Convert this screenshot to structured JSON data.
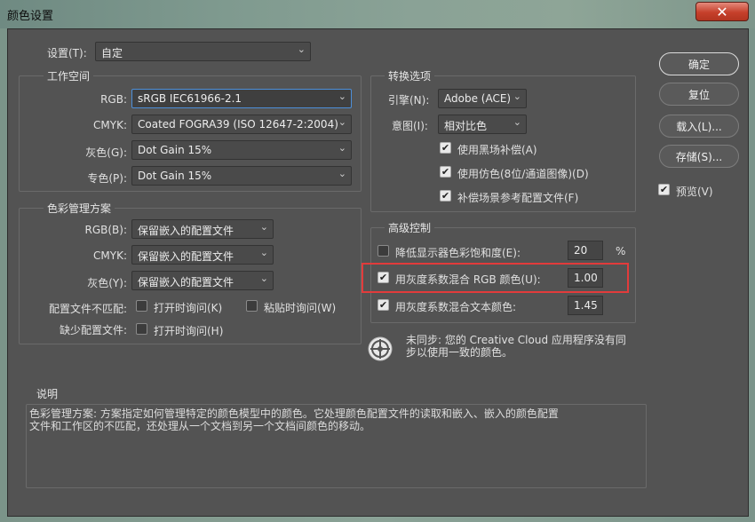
{
  "window": {
    "title": "颜色设置",
    "close_glyph": "✕"
  },
  "settings": {
    "label": "设置(T):",
    "value": "自定"
  },
  "workspace": {
    "title": "工作空间",
    "rgb": {
      "label": "RGB:",
      "value": "sRGB IEC61966-2.1"
    },
    "cmyk": {
      "label": "CMYK:",
      "value": "Coated FOGRA39 (ISO 12647-2:2004)"
    },
    "gray": {
      "label": "灰色(G):",
      "value": "Dot Gain 15%"
    },
    "spot": {
      "label": "专色(P):",
      "value": "Dot Gain 15%"
    }
  },
  "policies": {
    "title": "色彩管理方案",
    "rgb": {
      "label": "RGB(B):",
      "value": "保留嵌入的配置文件"
    },
    "cmyk": {
      "label": "CMYK:",
      "value": "保留嵌入的配置文件"
    },
    "gray": {
      "label": "灰色(Y):",
      "value": "保留嵌入的配置文件"
    },
    "mismatch_label": "配置文件不匹配:",
    "ask_open": "打开时询问(K)",
    "ask_paste": "粘贴时询问(W)",
    "missing_label": "缺少配置文件:",
    "ask_open_missing": "打开时询问(H)"
  },
  "conversion": {
    "title": "转换选项",
    "engine": {
      "label": "引擎(N):",
      "value": "Adobe (ACE)"
    },
    "intent": {
      "label": "意图(I):",
      "value": "相对比色"
    },
    "bpc": {
      "label": "使用黑场补偿(A)",
      "checked": true
    },
    "dither": {
      "label": "使用仿色(8位/通道图像)(D)",
      "checked": true
    },
    "compensate": {
      "label": "补偿场景参考配置文件(F)",
      "checked": true
    }
  },
  "advanced": {
    "title": "高级控制",
    "desaturate": {
      "label": "降低显示器色彩饱和度(E):",
      "value": "20",
      "unit": "%",
      "checked": false
    },
    "blend_rgb": {
      "label": "用灰度系数混合 RGB 颜色(U):",
      "value": "1.00",
      "checked": true
    },
    "blend_text": {
      "label": "用灰度系数混合文本颜色:",
      "value": "1.45",
      "checked": true
    }
  },
  "sync": {
    "text_line1": "未同步: 您的 Creative Cloud 应用程序没有同",
    "text_line2": "步以使用一致的颜色。",
    "icon": "sync-status-icon"
  },
  "description": {
    "title": "说明",
    "line1": "色彩管理方案: 方案指定如何管理特定的颜色模型中的颜色。它处理颜色配置文件的读取和嵌入、嵌入的颜色配置",
    "line2": "文件和工作区的不匹配，还处理从一个文档到另一个文档间颜色的移动。"
  },
  "buttons": {
    "ok": "确定",
    "reset": "复位",
    "load": "载入(L)...",
    "save": "存储(S)...",
    "preview": "预览(V)",
    "preview_checked": true
  },
  "check_glyph": "✔",
  "arrow_glyph": "⌄"
}
